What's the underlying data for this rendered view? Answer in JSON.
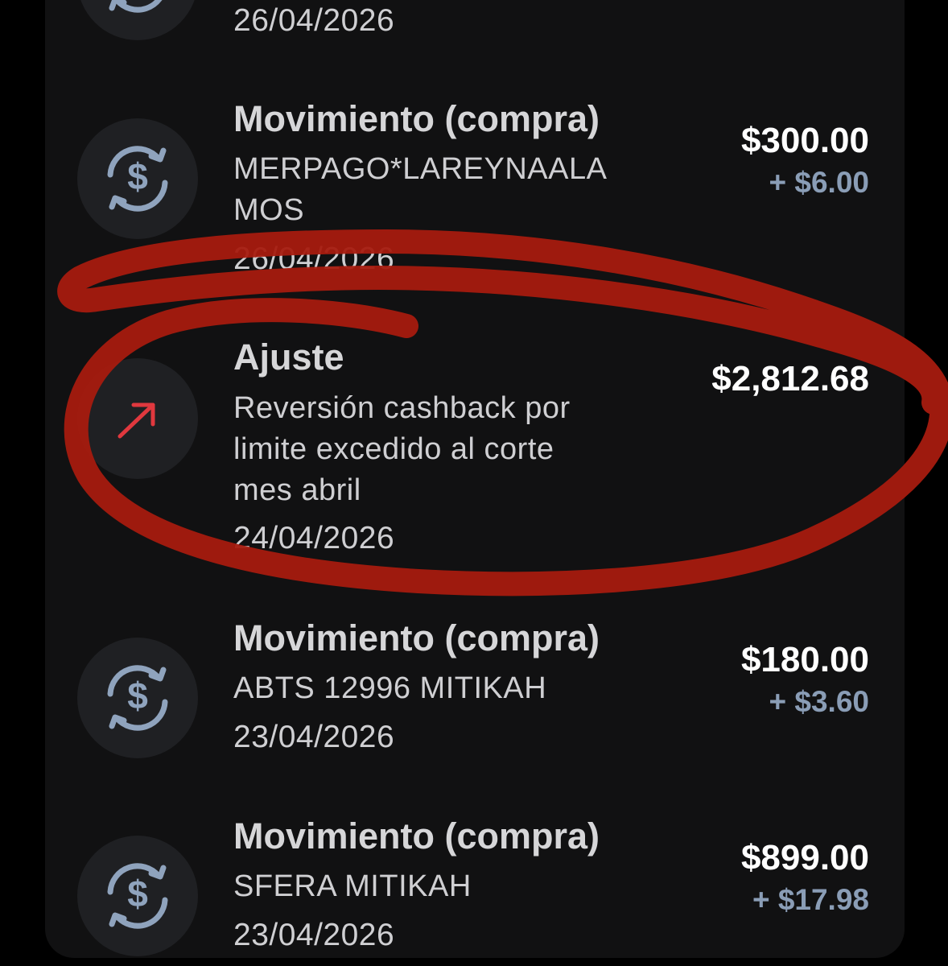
{
  "colors": {
    "background": "#000000",
    "card": "#111112",
    "icon_bg": "#1f2023",
    "icon_blue": "#8fa3bd",
    "adjust_arrow_red": "#e0383e",
    "cashback_blue": "#8a9db6",
    "annotation_red": "#a61b0f"
  },
  "transactions": [
    {
      "icon": "currency-exchange-icon",
      "date": "26/04/2026"
    },
    {
      "icon": "currency-exchange-icon",
      "title": "Movimiento (compra)",
      "description": "MERPAGO*LAREYNAALAMOS",
      "description_line1": "MERPAGO*LAREYNAALA",
      "description_line2": "MOS",
      "date": "26/04/2026",
      "amount": "$300.00",
      "cashback": "+ $6.00"
    },
    {
      "icon": "arrow-up-right-icon",
      "title": "Ajuste",
      "description": "Reversión cashback por limite excedido al corte mes abril",
      "description_line1": "Reversión cashback por",
      "description_line2": "limite excedido al corte",
      "description_line3": "mes abril",
      "date": "24/04/2026",
      "amount": "$2,812.68"
    },
    {
      "icon": "currency-exchange-icon",
      "title": "Movimiento (compra)",
      "description": "ABTS 12996 MITIKAH",
      "date": "23/04/2026",
      "amount": "$180.00",
      "cashback": "+ $3.60"
    },
    {
      "icon": "currency-exchange-icon",
      "title": "Movimiento (compra)",
      "description": "SFERA MITIKAH",
      "date": "23/04/2026",
      "amount": "$899.00",
      "cashback": "+ $17.98"
    }
  ]
}
